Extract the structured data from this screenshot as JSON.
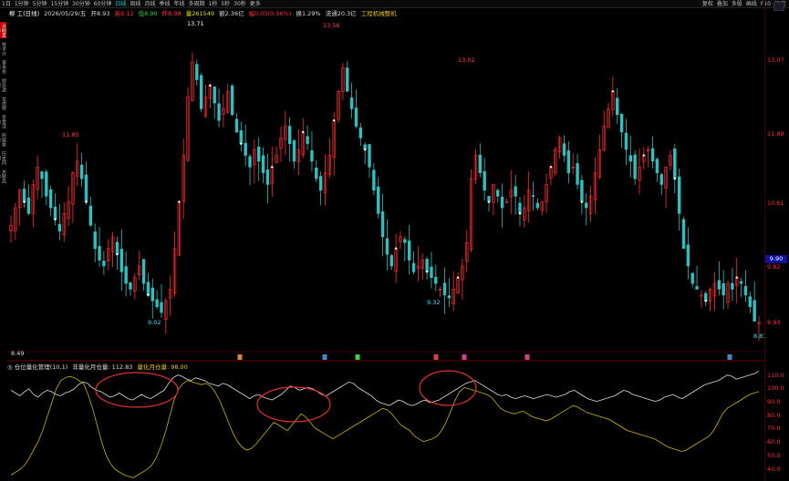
{
  "topbar": {
    "items": [
      "1日",
      "1分钟",
      "5分钟",
      "15分钟",
      "30分钟",
      "60分钟",
      "日线",
      "周线",
      "月线",
      "季线",
      "年线",
      "多周期",
      "1秒",
      "5秒",
      "30秒",
      "更多"
    ],
    "active_index": 6,
    "right_items": [
      "复权",
      "叠加",
      "多股",
      "画线",
      "F10",
      "标记"
    ]
  },
  "infobar": {
    "name": "柳 工(日线)",
    "date": "2026/05/29/五",
    "close_label": "开8.93",
    "high_label": "高9.12",
    "low_label": "低8.90",
    "prev_label": "昨8.98",
    "volume_label": "量261549",
    "amount_label": "额2.36亿",
    "change_label": "幅0.05(0.56%)",
    "turnover_label": "换1.29%",
    "float_label": "流通20.3亿",
    "industry_label": "工程机械整机"
  },
  "sidetabs": [
    "分时走势",
    "技术分析",
    "基本资料",
    "财务透视",
    "龙虎榜",
    "资金流向",
    "所属板块",
    "历史同期",
    "关联品种"
  ],
  "price_labels": {
    "high1": "11.85",
    "low1": "9.02",
    "high2": "13.71",
    "high3": "13.56",
    "low2": "9.32",
    "high4": "13.02",
    "last_low": "8.81",
    "bottom_left": "8.49"
  },
  "right_axis": {
    "main": [
      "13.07",
      "11.89",
      "10.61",
      "9.82",
      "8.93"
    ],
    "current_price": "9.90",
    "indicator": [
      "110.0",
      "100.0",
      "90.0",
      "80.0",
      "70.0",
      "60.0",
      "50.0",
      "40.0"
    ]
  },
  "indicator": {
    "name": "◎ 仓位量化管理(10,1)",
    "line1_label": "非量化月仓量: 112.83",
    "line2_label": "量化月仓量: 98.00"
  },
  "markers": [
    "融",
    "融",
    "融",
    "融",
    "融",
    "融",
    "融"
  ],
  "colors": {
    "up": "#ff3030",
    "down": "#30c0c0",
    "line1": "#dddddd",
    "line2": "#c8b400",
    "ellipse": "#e03030",
    "active_tab": "#c00000"
  },
  "chart_data": {
    "type": "candlestick-with-indicator",
    "main_ylim": [
      8.49,
      14.0
    ],
    "key_points": [
      {
        "label": "11.85",
        "value": 11.85
      },
      {
        "label": "9.02",
        "value": 9.02
      },
      {
        "label": "13.71",
        "value": 13.71
      },
      {
        "label": "13.56",
        "value": 13.56
      },
      {
        "label": "9.32",
        "value": 9.32
      },
      {
        "label": "13.02",
        "value": 13.02
      },
      {
        "label": "8.81",
        "value": 8.81
      }
    ],
    "closes": [
      10.6,
      10.9,
      11.2,
      11.0,
      10.8,
      11.3,
      11.6,
      11.4,
      11.1,
      10.9,
      10.7,
      10.5,
      10.8,
      11.0,
      11.5,
      11.7,
      11.4,
      11.0,
      10.6,
      10.2,
      10.0,
      9.9,
      10.2,
      10.4,
      10.1,
      9.8,
      9.6,
      9.5,
      9.7,
      9.9,
      9.6,
      9.4,
      9.3,
      9.2,
      9.1,
      9.3,
      9.5,
      10.2,
      11.0,
      11.8,
      12.8,
      13.4,
      13.1,
      12.6,
      12.8,
      13.0,
      12.7,
      12.4,
      12.6,
      12.9,
      12.5,
      12.2,
      12.0,
      11.8,
      11.6,
      11.9,
      11.7,
      11.5,
      11.3,
      11.6,
      11.8,
      12.1,
      12.3,
      12.0,
      11.7,
      11.9,
      12.2,
      12.0,
      11.7,
      11.4,
      11.2,
      11.5,
      11.8,
      12.4,
      12.9,
      13.3,
      12.9,
      12.6,
      12.3,
      12.1,
      11.9,
      11.6,
      11.2,
      10.8,
      10.4,
      10.1,
      9.9,
      10.2,
      10.4,
      10.3,
      10.0,
      9.8,
      9.9,
      10.0,
      9.8,
      9.7,
      9.6,
      9.5,
      9.4,
      9.35,
      9.5,
      9.7,
      9.9,
      10.3,
      11.4,
      11.8,
      11.5,
      11.2,
      11.0,
      11.3,
      11.1,
      10.9,
      11.0,
      11.2,
      11.1,
      10.8,
      10.9,
      11.2,
      11.1,
      10.9,
      11.0,
      11.3,
      11.6,
      11.9,
      12.1,
      11.8,
      11.5,
      11.6,
      11.3,
      11.0,
      10.9,
      11.1,
      11.5,
      11.9,
      12.3,
      12.6,
      12.9,
      12.5,
      12.2,
      11.9,
      11.7,
      11.4,
      11.6,
      11.8,
      11.9,
      11.7,
      11.5,
      11.3,
      11.6,
      11.8,
      11.4,
      10.8,
      10.2,
      9.9,
      9.6,
      9.5,
      9.4,
      9.3,
      9.5,
      9.6,
      9.5,
      9.4,
      9.6,
      9.5,
      9.7,
      9.6,
      9.4,
      9.2,
      8.95,
      8.93
    ],
    "indicator_ylim": [
      35,
      115
    ],
    "series": [
      {
        "name": "非量化月仓量",
        "values": [
          99,
          97,
          95,
          98,
          100,
          96,
          94,
          97,
          99,
          98,
          96,
          95,
          97,
          98,
          100,
          103,
          105,
          104,
          101,
          99,
          98,
          96,
          94,
          95,
          97,
          95,
          93,
          92,
          94,
          96,
          94,
          93,
          95,
          97,
          99,
          104,
          108,
          110,
          109,
          107,
          106,
          108,
          107,
          106,
          104,
          103,
          102,
          104,
          103,
          101,
          99,
          97,
          95,
          93,
          95,
          96,
          94,
          93,
          92,
          94,
          96,
          99,
          102,
          101,
          99,
          100,
          101,
          100,
          98,
          96,
          95,
          97,
          99,
          101,
          103,
          105,
          104,
          101,
          99,
          97,
          95,
          92,
          90,
          89,
          88,
          90,
          92,
          91,
          89,
          88,
          89,
          91,
          92,
          90,
          91,
          92,
          94,
          96,
          98,
          100,
          102,
          104,
          105,
          106,
          104,
          102,
          100,
          98,
          96,
          95,
          96,
          94,
          93,
          94,
          95,
          94,
          93,
          94,
          95,
          96,
          95,
          94,
          95,
          96,
          98,
          99,
          97,
          95,
          93,
          92,
          91,
          92,
          93,
          94,
          95,
          97,
          99,
          98,
          96,
          95,
          94,
          93,
          92,
          91,
          92,
          94,
          95,
          96,
          94,
          93,
          95,
          97,
          99,
          101,
          103,
          104,
          105,
          106,
          108,
          110,
          109,
          107,
          108,
          109,
          110,
          111,
          112.83
        ]
      },
      {
        "name": "量化月仓量",
        "values": [
          38,
          40,
          42,
          45,
          50,
          56,
          62,
          70,
          80,
          90,
          100,
          106,
          108,
          109,
          108,
          106,
          104,
          96,
          86,
          74,
          62,
          52,
          46,
          42,
          40,
          38,
          37,
          36,
          38,
          40,
          42,
          45,
          50,
          58,
          68,
          80,
          92,
          100,
          104,
          106,
          105,
          104,
          103,
          104,
          102,
          98,
          92,
          84,
          76,
          68,
          62,
          58,
          56,
          57,
          60,
          64,
          68,
          72,
          76,
          74,
          72,
          70,
          74,
          78,
          82,
          80,
          76,
          72,
          70,
          68,
          66,
          64,
          66,
          68,
          70,
          72,
          74,
          76,
          78,
          80,
          82,
          84,
          86,
          85,
          82,
          78,
          74,
          72,
          70,
          66,
          64,
          62,
          63,
          64,
          66,
          70,
          76,
          84,
          92,
          98,
          101,
          100,
          99,
          98,
          97,
          96,
          94,
          90,
          86,
          84,
          83,
          82,
          83,
          84,
          82,
          80,
          79,
          78,
          77,
          78,
          80,
          82,
          84,
          86,
          88,
          87,
          85,
          83,
          82,
          81,
          80,
          79,
          78,
          76,
          74,
          72,
          70,
          69,
          68,
          67,
          66,
          65,
          64,
          62,
          60,
          58,
          57,
          56,
          55,
          56,
          58,
          60,
          62,
          64,
          66,
          70,
          76,
          82,
          86,
          88,
          90,
          92,
          94,
          96,
          97,
          98
        ]
      }
    ]
  }
}
